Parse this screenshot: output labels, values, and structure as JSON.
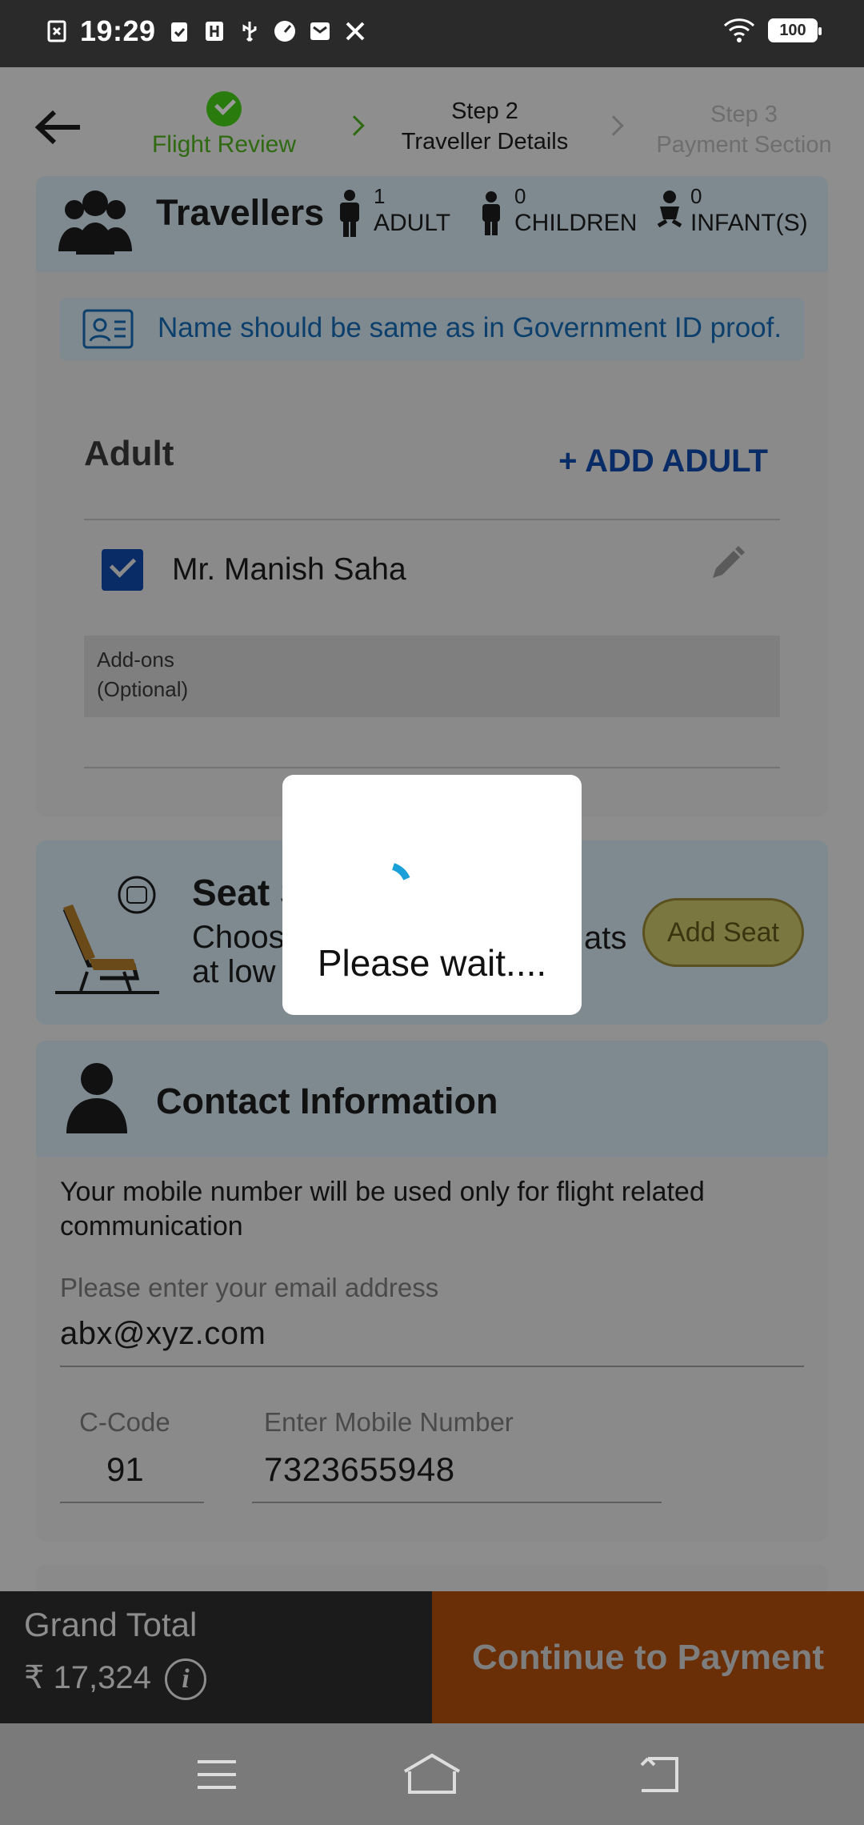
{
  "status_bar": {
    "time": "19:29",
    "battery": "100",
    "left_icons": [
      "screenshot-icon",
      "clipboard-check-icon",
      "usb-debug-icon",
      "usb-icon",
      "speedometer-icon",
      "mail-icon",
      "tools-icon"
    ],
    "right_icons": [
      "wifi-icon",
      "battery-icon"
    ]
  },
  "header": {
    "steps": [
      {
        "title": "",
        "label": "Flight Review",
        "state": "done"
      },
      {
        "title": "Step 2",
        "label": "Traveller Details",
        "state": "active"
      },
      {
        "title": "Step 3",
        "label": "Payment Section",
        "state": "pending"
      }
    ],
    "colors": {
      "done": "#2f6a12",
      "active": "#111111",
      "pending": "#6e6e6e"
    }
  },
  "travellers": {
    "title": "Travellers",
    "pax": [
      {
        "count": "1",
        "label": "ADULT"
      },
      {
        "count": "0",
        "label": "CHILDREN"
      },
      {
        "count": "0",
        "label": "INFANT(S)"
      }
    ],
    "notice": "Name should be same as in Government ID proof.",
    "adult_label": "Adult",
    "add_adult": "+ ADD ADULT",
    "traveller_name": "Mr. Manish Saha",
    "addons_line1": "Add-ons",
    "addons_line2": "(Optional)"
  },
  "seat": {
    "title": "Seat S",
    "sub_line1": "Choos",
    "sub_line2": "at low",
    "sub_right": "ats",
    "button": "Add Seat"
  },
  "contact": {
    "title": "Contact Information",
    "description": "Your mobile number will be used only for flight related communication",
    "email_label": "Please enter your email address",
    "email_value": "abx@xyz.com",
    "code_label": "C-Code",
    "code_value": "91",
    "mobile_label": "Enter Mobile Number",
    "mobile_value": "7323655948"
  },
  "footer": {
    "total_label": "Grand Total",
    "total_value": "₹ 17,324",
    "info_glyph": "i",
    "pay_button": "Continue to Payment"
  },
  "dialog": {
    "text": "Please wait....",
    "accent": "#1aa0d8"
  },
  "navbar": {
    "buttons": [
      "menu-icon",
      "home-icon",
      "back-icon"
    ]
  }
}
